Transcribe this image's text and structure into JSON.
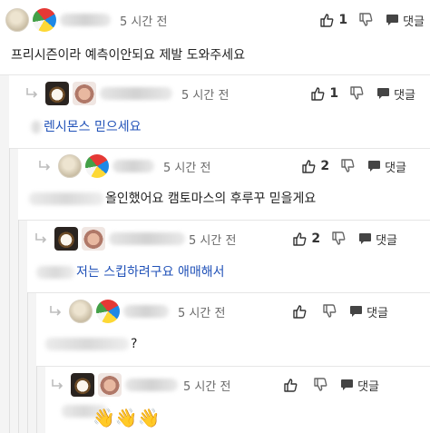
{
  "labels": {
    "reply": "댓글",
    "time": "5 시간 전"
  },
  "comments": [
    {
      "time": "5 시간 전",
      "likes": "1",
      "text": "프리시즌이라 예측이안되요 제발 도와주세요"
    },
    {
      "time": "5 시간 전",
      "likes": "1",
      "text": "렌시몬스 믿으세요"
    },
    {
      "time": "5 시간 전",
      "likes": "2",
      "text": "올인했어요 캠토마스의 후루꾸 믿을게요"
    },
    {
      "time": "5 시간 전",
      "likes": "2",
      "text": "저는 스킵하려구요 애매해서"
    },
    {
      "time": "5 시간 전",
      "likes": "",
      "text": "?"
    },
    {
      "time": "5 시간 전",
      "likes": "",
      "text": "👋👋👋"
    }
  ],
  "colors": {
    "link": "#2152b8",
    "thread_band": "#f4f4f4",
    "separator": "#e6e6e6"
  },
  "icons": {
    "like": "thumbs-up-icon",
    "dislike": "thumbs-down-icon",
    "reply": "speech-bubble-icon",
    "nested": "reply-arrow-icon"
  }
}
